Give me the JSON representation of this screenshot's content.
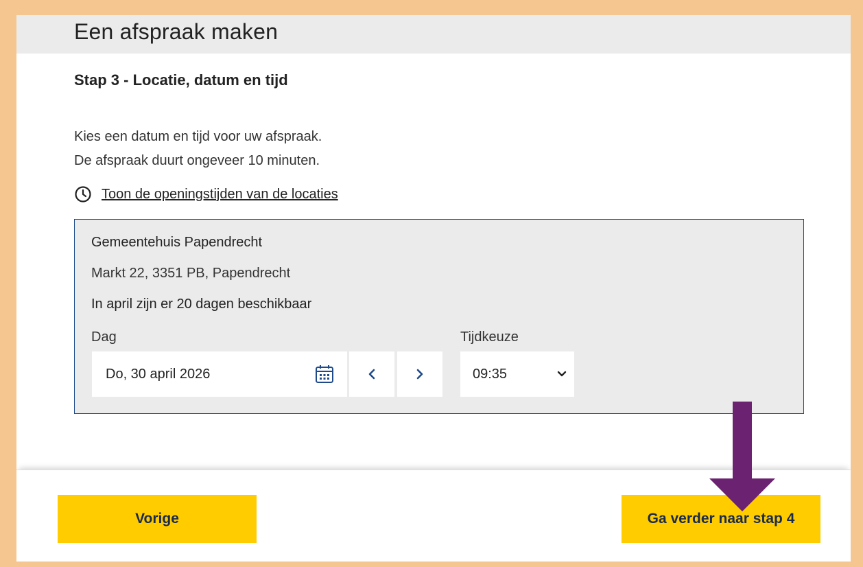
{
  "page": {
    "title": "Een afspraak maken",
    "step_title": "Stap 3 - Locatie, datum en tijd",
    "intro_lines": [
      "Kies een datum en tijd voor uw afspraak.",
      "De afspraak duurt ongeveer 10 minuten."
    ],
    "opening_hours_link": "Toon de openingstijden van de locaties"
  },
  "location": {
    "name": "Gemeentehuis Papendrecht",
    "address": "Markt 22, 3351 PB, Papendrecht",
    "availability": "In april zijn er 20 dagen beschikbaar",
    "day_label": "Dag",
    "date_value": "Do, 30 april 2026",
    "time_label": "Tijdkeuze",
    "time_value": "09:35"
  },
  "footer": {
    "prev_label": "Vorige",
    "next_label": "Ga verder naar stap 4"
  },
  "icons": {
    "clock": "clock-icon",
    "calendar": "calendar-icon",
    "prev": "chevron-left-icon",
    "next": "chevron-right-icon",
    "dropdown": "chevron-down-icon",
    "annotation": "arrow-down-icon"
  },
  "colors": {
    "outer_background": "#f5c68f",
    "header_background": "#ebebeb",
    "box_border": "#1e4a8a",
    "button_background": "#ffcc00",
    "button_text": "#1b2b4b",
    "annotation_arrow": "#6b2270"
  }
}
